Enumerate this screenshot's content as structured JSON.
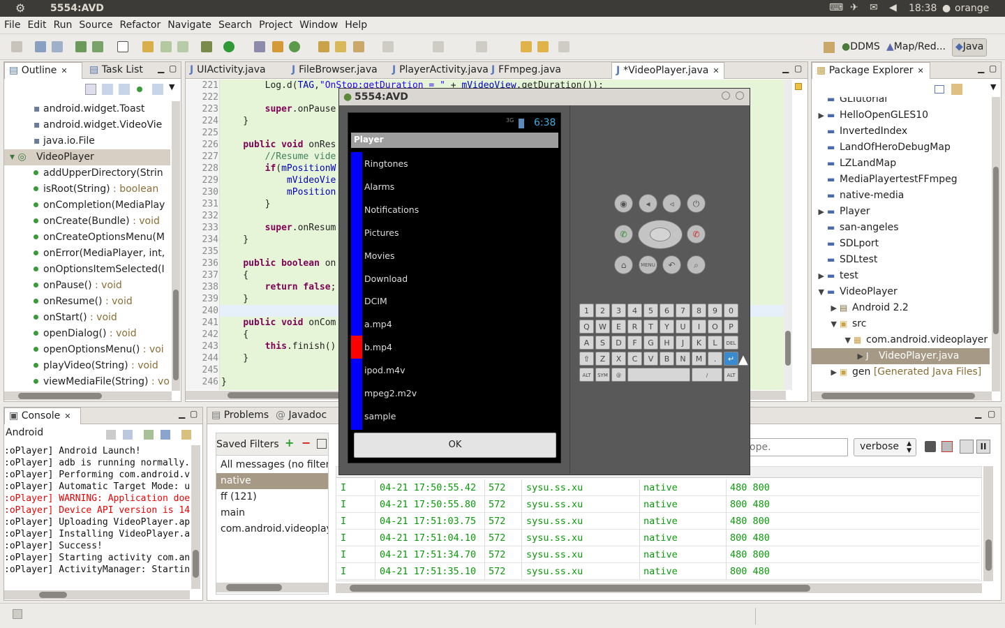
{
  "topbar": {
    "title": "5554:AVD",
    "time": "18:38",
    "user": "orange"
  },
  "menu": [
    "File",
    "Edit",
    "Run",
    "Source",
    "Refactor",
    "Navigate",
    "Search",
    "Project",
    "Window",
    "Help"
  ],
  "perspectives": [
    "DDMS",
    "Map/Red...",
    "Java"
  ],
  "outline": {
    "tabs": [
      "Outline",
      "Task List"
    ],
    "rows": [
      {
        "text": "android.widget.Toast",
        "ret": ""
      },
      {
        "text": "android.widget.VideoVie",
        "ret": ""
      },
      {
        "text": "java.io.File",
        "ret": ""
      },
      {
        "text": "VideoPlayer",
        "ret": ""
      },
      {
        "text": "addUpperDirectory(Strin",
        "ret": ""
      },
      {
        "text": "isRoot(String)",
        "ret": " : boolean"
      },
      {
        "text": "onCompletion(MediaPlay",
        "ret": ""
      },
      {
        "text": "onCreate(Bundle)",
        "ret": " : void"
      },
      {
        "text": "onCreateOptionsMenu(M",
        "ret": ""
      },
      {
        "text": "onError(MediaPlayer, int,",
        "ret": ""
      },
      {
        "text": "onOptionsItemSelected(I",
        "ret": ""
      },
      {
        "text": "onPause()",
        "ret": " : void"
      },
      {
        "text": "onResume()",
        "ret": " : void"
      },
      {
        "text": "onStart()",
        "ret": " : void"
      },
      {
        "text": "openDialog()",
        "ret": " : void"
      },
      {
        "text": "openOptionsMenu()",
        "ret": " : voi"
      },
      {
        "text": "playVideo(String)",
        "ret": " : void"
      },
      {
        "text": "viewMediaFile(String)",
        "ret": " : vo"
      }
    ]
  },
  "editor": {
    "tabs": [
      "UIActivity.java",
      "FileBrowser.java",
      "PlayerActivity.java",
      "FFmpeg.java",
      "*VideoPlayer.java"
    ],
    "line_numbers": [
      "221",
      "222",
      "223",
      "224",
      "225",
      "226",
      "227",
      "228",
      "229",
      "230",
      "231",
      "232",
      "233",
      "234",
      "235",
      "236",
      "237",
      "238",
      "239",
      "240",
      "241",
      "242",
      "243",
      "244",
      "245",
      "246"
    ],
    "code": [
      "        Log.d(TAG,\"OnStop:getDuration = \" + mVideoView.getDuration());",
      "",
      "        super.onPause",
      "    }",
      "",
      "    public void onRes",
      "        //Resume vide",
      "        if(mPositionW",
      "            mVideoVie",
      "            mPosition",
      "        }",
      "",
      "        super.onResum",
      "    }",
      "",
      "    public boolean on",
      "    {",
      "        return false;",
      "    }",
      "",
      "    public void onCom",
      "    {",
      "        this.finish()",
      "    }",
      "",
      "}"
    ]
  },
  "avd": {
    "title": "5554:AVD",
    "status_time": "6:38",
    "signal": "3G",
    "dialog_title": "Player",
    "items": [
      "Ringtones",
      "Alarms",
      "Notifications",
      "Pictures",
      "Movies",
      "Download",
      "DCIM",
      "a.mp4",
      "b.mp4",
      "ipod.m4v",
      "mpeg2.m2v",
      "sample"
    ],
    "selected_index": 8,
    "ok_label": "OK",
    "keyboard_rows": [
      [
        "1",
        "2",
        "3",
        "4",
        "5",
        "6",
        "7",
        "8",
        "9",
        "0"
      ],
      [
        "Q",
        "W",
        "E",
        "R",
        "T",
        "Y",
        "U",
        "I",
        "O",
        "P"
      ],
      [
        "A",
        "S",
        "D",
        "F",
        "G",
        "H",
        "J",
        "K",
        "L",
        "DEL"
      ],
      [
        "⇧",
        "Z",
        "X",
        "C",
        "V",
        "B",
        "N",
        "M",
        ".",
        "↵"
      ]
    ],
    "keyboard_bottom": [
      "ALT",
      "SYM",
      "@",
      "",
      "/",
      "ALT"
    ],
    "menu_key": "MENU",
    "colors": {
      "bar": "#0000ff",
      "selected": "#ff0000"
    }
  },
  "package_explorer": {
    "title": "Package Explorer",
    "rows": [
      {
        "text": "GLTutorial",
        "extra": ""
      },
      {
        "text": "HelloOpenGLES10",
        "extra": ""
      },
      {
        "text": "InvertedIndex",
        "extra": ""
      },
      {
        "text": "LandOfHeroDebugMap",
        "extra": ""
      },
      {
        "text": "LZLandMap",
        "extra": ""
      },
      {
        "text": "MediaPlayertestFFmpeg",
        "extra": ""
      },
      {
        "text": "native-media",
        "extra": ""
      },
      {
        "text": "Player",
        "extra": ""
      },
      {
        "text": "san-angeles",
        "extra": ""
      },
      {
        "text": "SDLport",
        "extra": ""
      },
      {
        "text": "SDLtest",
        "extra": ""
      },
      {
        "text": "test",
        "extra": ""
      },
      {
        "text": "VideoPlayer",
        "extra": ""
      },
      {
        "text": "Android 2.2",
        "extra": ""
      },
      {
        "text": "src",
        "extra": ""
      },
      {
        "text": "com.android.videoplayer",
        "extra": ""
      },
      {
        "text": "VideoPlayer.java",
        "extra": ""
      },
      {
        "text": "gen",
        "extra": " [Generated Java Files]"
      }
    ]
  },
  "console": {
    "title": "Console",
    "label": "Android",
    "lines": [
      {
        "text": ":oPlayer] Android Launch!",
        "error": false
      },
      {
        "text": ":oPlayer] adb is running normally.",
        "error": false
      },
      {
        "text": ":oPlayer] Performing com.android.v",
        "error": false
      },
      {
        "text": ":oPlayer] Automatic Target Mode: u",
        "error": false
      },
      {
        "text": ":oPlayer] WARNING: Application doe",
        "error": true
      },
      {
        "text": ":oPlayer] Device API version is 14",
        "error": true
      },
      {
        "text": ":oPlayer] Uploading VideoPlayer.ap",
        "error": false
      },
      {
        "text": ":oPlayer] Installing VideoPlayer.a",
        "error": false
      },
      {
        "text": ":oPlayer] Success!",
        "error": false
      },
      {
        "text": ":oPlayer] Starting activity com.an",
        "error": false
      },
      {
        "text": ":oPlayer] ActivityManager: Startin",
        "error": false
      }
    ]
  },
  "problems": {
    "tabs": [
      "Problems",
      "Javadoc"
    ]
  },
  "logcat": {
    "saved_filters_label": "Saved Filters",
    "filters": [
      "All messages (no filters",
      "native",
      "ff (121)",
      "main",
      "com.android.videoplay"
    ],
    "search_placeholder": "ope.",
    "level": "verbose",
    "rows": [
      {
        "level": "I",
        "time": "04-21 17:50:55.42",
        "pid": "572",
        "app": "sysu.ss.xu",
        "tag": "native",
        "text": "480 800"
      },
      {
        "level": "I",
        "time": "04-21 17:50:55.80",
        "pid": "572",
        "app": "sysu.ss.xu",
        "tag": "native",
        "text": "800 480"
      },
      {
        "level": "I",
        "time": "04-21 17:51:03.75",
        "pid": "572",
        "app": "sysu.ss.xu",
        "tag": "native",
        "text": "480 800"
      },
      {
        "level": "I",
        "time": "04-21 17:51:04.10",
        "pid": "572",
        "app": "sysu.ss.xu",
        "tag": "native",
        "text": "800 480"
      },
      {
        "level": "I",
        "time": "04-21 17:51:34.70",
        "pid": "572",
        "app": "sysu.ss.xu",
        "tag": "native",
        "text": "480 800"
      },
      {
        "level": "I",
        "time": "04-21 17:51:35.10",
        "pid": "572",
        "app": "sysu.ss.xu",
        "tag": "native",
        "text": "800 480"
      }
    ]
  }
}
